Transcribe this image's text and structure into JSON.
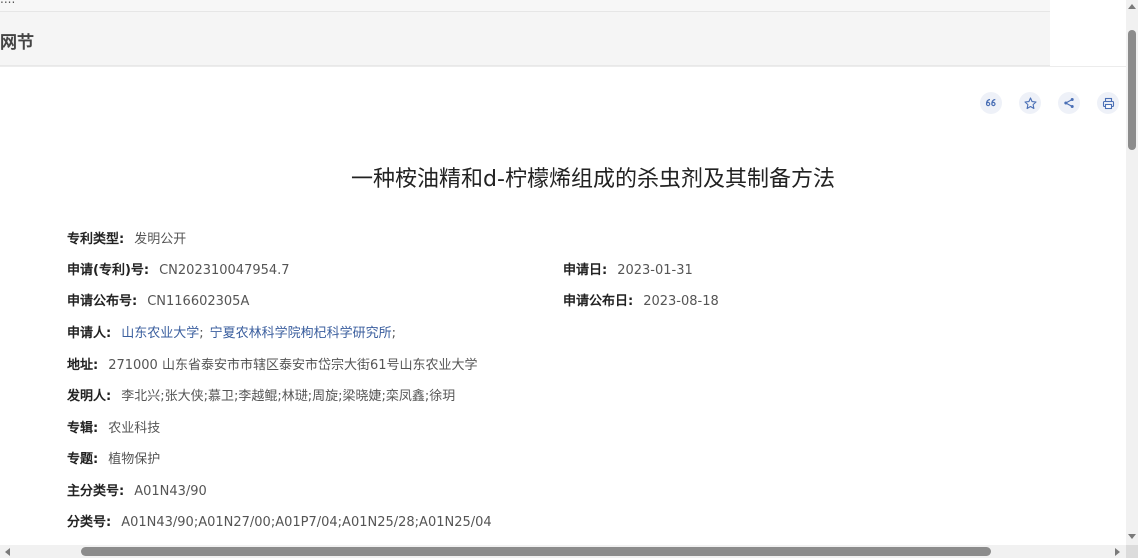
{
  "top_strip": {
    "text": "...."
  },
  "header": {
    "title": "网节"
  },
  "toolbar": {
    "icons": [
      "quote-icon",
      "star-icon",
      "share-icon",
      "print-icon"
    ],
    "icon_color": "#4a6fb5"
  },
  "document": {
    "title": "一种桉油精和d-柠檬烯组成的杀虫剂及其制备方法",
    "fields": {
      "patent_type": {
        "label": "专利类型:",
        "value": "发明公开"
      },
      "application_no": {
        "label": "申请(专利)号:",
        "value": "CN202310047954.7"
      },
      "application_date": {
        "label": "申请日:",
        "value": "2023-01-31"
      },
      "publication_no": {
        "label": "申请公布号:",
        "value": "CN116602305A"
      },
      "publication_date": {
        "label": "申请公布日:",
        "value": "2023-08-18"
      },
      "applicant": {
        "label": "申请人:",
        "values": [
          "山东农业大学",
          "宁夏农林科学院枸杞科学研究所"
        ],
        "separator": ";"
      },
      "address": {
        "label": "地址:",
        "value": "271000 山东省泰安市市辖区泰安市岱宗大街61号山东农业大学"
      },
      "inventors": {
        "label": "发明人:",
        "value": "李北兴;张大侠;慕卫;李越鲲;林琎;周旋;梁晓婕;栾凤鑫;徐玥"
      },
      "series": {
        "label": "专辑:",
        "value": "农业科技"
      },
      "topic": {
        "label": "专题:",
        "value": "植物保护"
      },
      "main_class": {
        "label": "主分类号:",
        "value": "A01N43/90"
      },
      "classes": {
        "label": "分类号:",
        "value": "A01N43/90;A01N27/00;A01P7/04;A01N25/28;A01N25/04"
      }
    }
  },
  "colors": {
    "link": "#3a5e9e",
    "label": "#222222",
    "value": "#555555",
    "header_bg": "#f5f5f5"
  }
}
